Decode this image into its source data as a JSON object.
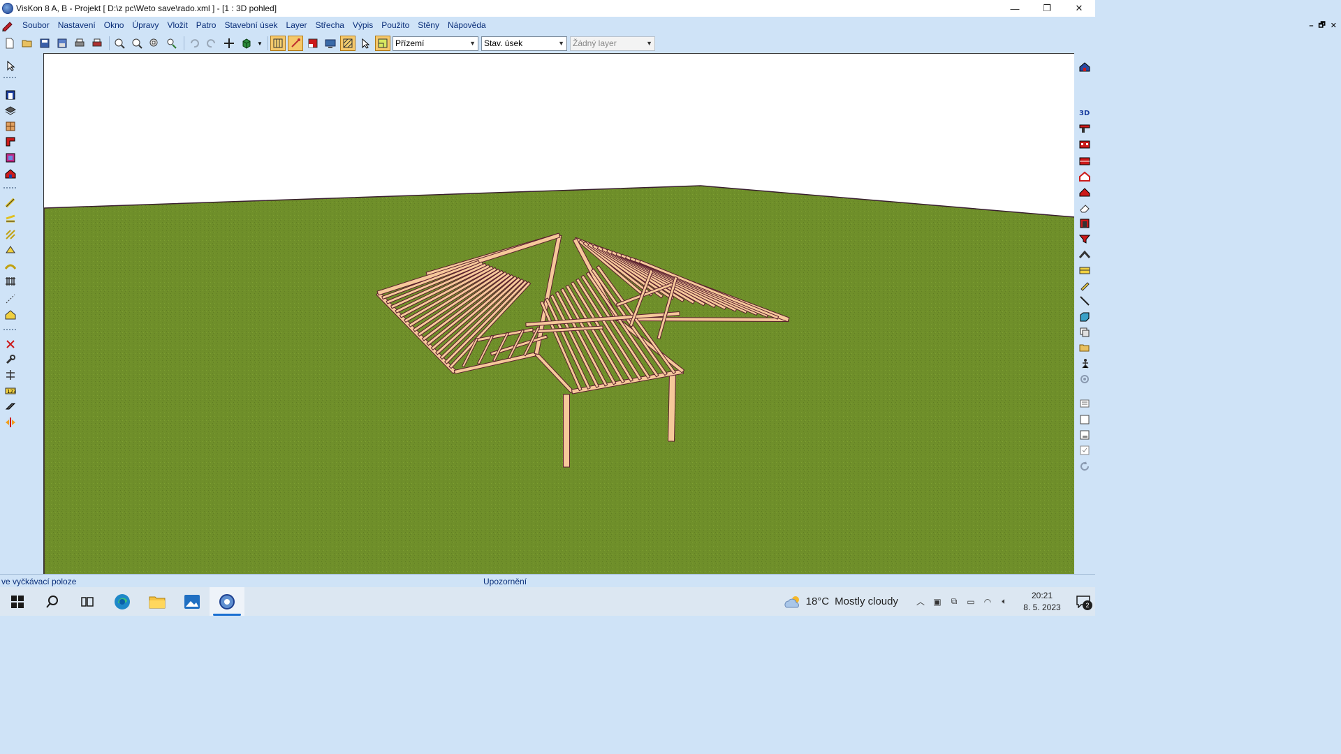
{
  "window": {
    "title": "VisKon 8 A, B - Projekt [ D:\\z pc\\Weto save\\rado.xml ]  - [1 : 3D pohled]",
    "controls": {
      "minimize": "—",
      "restore": "❐",
      "close": "✕"
    }
  },
  "menubar": {
    "items": [
      "Soubor",
      "Nastavení",
      "Okno",
      "Úpravy",
      "Vložit",
      "Patro",
      "Stavební úsek",
      "Layer",
      "Střecha",
      "Výpis",
      "Použito",
      "Stěny",
      "Nápověda"
    ],
    "mdi_controls": {
      "minimize": "–",
      "restore": "🗗",
      "close": "✕"
    }
  },
  "toolbar": {
    "floor_select": "Přízemí",
    "section_select": "Stav. úsek",
    "layer_select": "Žádný layer"
  },
  "viewport": {
    "view_name": "1 : 3D pohled",
    "sky_color": "#ffffff",
    "ground_color": "#6f8f2a",
    "timber_color": "#f6c89a",
    "timber_edge": "#5a1f2e"
  },
  "statusbar": {
    "left": "ve vyčkávací poloze",
    "center": "Upozornění"
  },
  "taskbar": {
    "weather_temp": "18°C",
    "weather_text": "Mostly cloudy",
    "time": "20:21",
    "date": "8. 5. 2023",
    "notifications": "2"
  }
}
